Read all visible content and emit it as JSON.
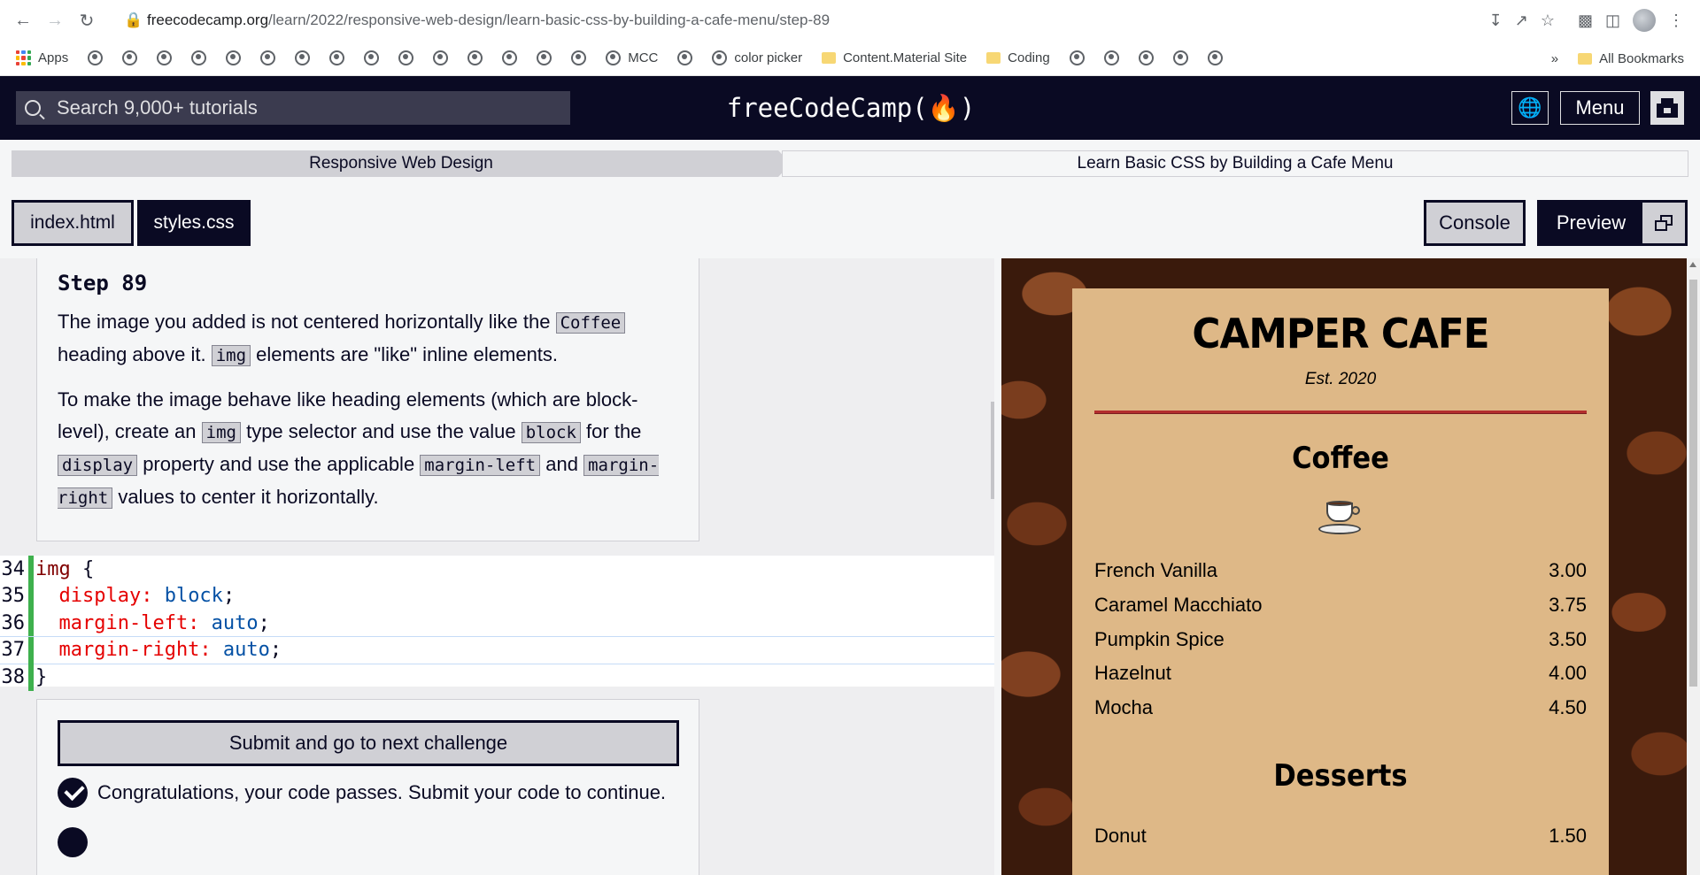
{
  "browser": {
    "url_host": "freecodecamp.org",
    "url_path": "/learn/2022/responsive-web-design/learn-basic-css-by-building-a-cafe-menu/step-89",
    "bookmarks": {
      "apps": "Apps",
      "mcc": "MCC",
      "color_picker": "color picker",
      "content_material": "Content.Material Site",
      "coding": "Coding",
      "all_bookmarks": "All Bookmarks",
      "overflow": "»"
    }
  },
  "nav": {
    "search_placeholder": "Search 9,000+ tutorials",
    "logo": "freeCodeCamp(🔥)",
    "menu_label": "Menu",
    "lang_icon": "globe-icon"
  },
  "breadcrumb": {
    "course": "Responsive Web Design",
    "project": "Learn Basic CSS by Building a Cafe Menu"
  },
  "tabs": {
    "index": "index.html",
    "styles": "styles.css",
    "console": "Console",
    "preview": "Preview"
  },
  "instructions": {
    "step": "Step 89",
    "p1_a": "The image you added is not centered horizontally like the ",
    "p1_code1": "Coffee",
    "p1_b": " heading above it. ",
    "p1_code2": "img",
    "p1_c": " elements are \"like\" inline elements.",
    "p2_a": "To make the image behave like heading elements (which are block-level), create an ",
    "p2_code1": "img",
    "p2_b": " type selector and use the value ",
    "p2_code2": "block",
    "p2_c": " for the ",
    "p2_code3": "display",
    "p2_d": " property and use the applicable ",
    "p2_code4": "margin-left",
    "p2_e": " and ",
    "p2_code5": "margin-right",
    "p2_f": " values to center it horizontally."
  },
  "editor": {
    "lines": [
      {
        "num": "34",
        "sel": "img",
        "rest": " {"
      },
      {
        "num": "35",
        "prop": "  display:",
        "val": " block",
        "end": ";"
      },
      {
        "num": "36",
        "prop": "  margin-left:",
        "val": " auto",
        "end": ";"
      },
      {
        "num": "37",
        "prop": "  margin-right:",
        "val": " auto",
        "end": ";"
      },
      {
        "num": "38",
        "rest": "}"
      }
    ]
  },
  "actions": {
    "submit": "Submit and go to next challenge",
    "pass_message": "Congratulations, your code passes. Submit your code to continue."
  },
  "preview": {
    "cafe_name": "CAMPER CAFE",
    "est": "Est. 2020",
    "coffee_heading": "Coffee",
    "coffee_items": [
      {
        "name": "French Vanilla",
        "price": "3.00"
      },
      {
        "name": "Caramel Macchiato",
        "price": "3.75"
      },
      {
        "name": "Pumpkin Spice",
        "price": "3.50"
      },
      {
        "name": "Hazelnut",
        "price": "4.00"
      },
      {
        "name": "Mocha",
        "price": "4.50"
      }
    ],
    "desserts_heading": "Desserts",
    "dessert_items": [
      {
        "name": "Donut",
        "price": "1.50"
      }
    ]
  },
  "colors": {
    "fcc_dark": "#0a0a23",
    "menu_bg": "#deb887",
    "divider": "#b32d2d"
  }
}
